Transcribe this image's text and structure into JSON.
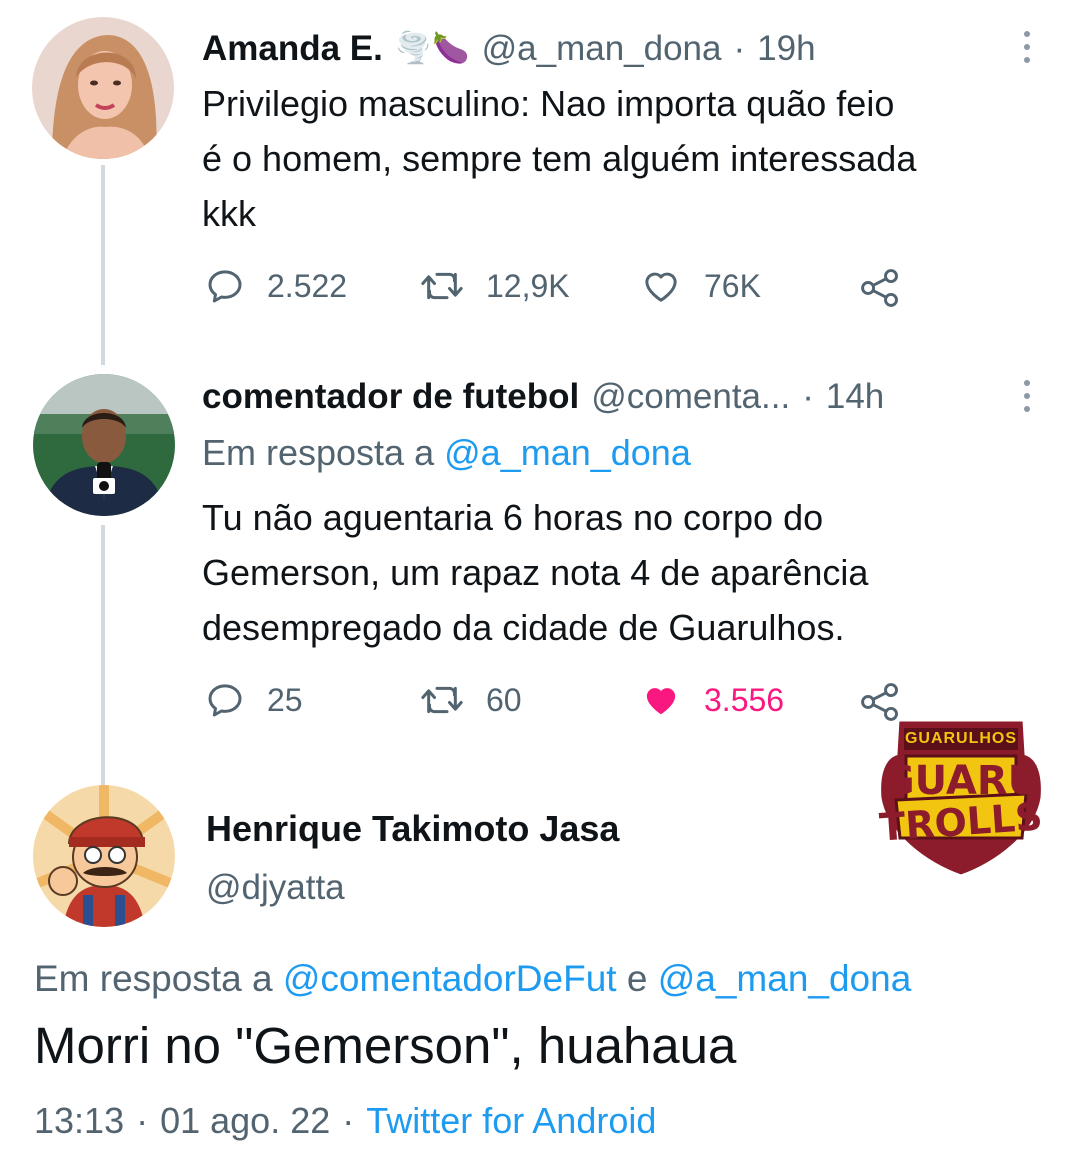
{
  "tweet1": {
    "name": "Amanda E.",
    "emojis": "🌪️🍆",
    "handle": "@a_man_dona",
    "separator": "·",
    "time": "19h",
    "text_lines": [
      "Privilegio masculino: Nao importa quão feio",
      "é o homem, sempre tem alguém interessada",
      "kkk"
    ],
    "replies": "2.522",
    "retweets": "12,9K",
    "likes": "76K",
    "liked": false
  },
  "tweet2": {
    "name": "comentador de futebol",
    "handle": "@comenta...",
    "separator": "·",
    "time": "14h",
    "replying_prefix": "Em resposta a",
    "replying_to": "@a_man_dona",
    "text_lines": [
      "Tu não aguentaria 6 horas no corpo do",
      "Gemerson, um rapaz nota 4 de aparência",
      "desempregado da cidade de Guarulhos."
    ],
    "replies": "25",
    "retweets": "60",
    "likes": "3.556",
    "liked": true
  },
  "tweet3": {
    "name": "Henrique Takimoto Jasa",
    "handle": "@djyatta",
    "replying_prefix": "Em resposta a",
    "replying_to_1": "@comentadorDeFut",
    "replying_conj": "e",
    "replying_to_2": "@a_man_dona",
    "text": "Morri no \"Gemerson\", huahaua",
    "time": "13:13",
    "sep1": "·",
    "date": "01 ago. 22",
    "sep2": "·",
    "source": "Twitter for Android"
  },
  "watermark": {
    "top": "GUARULHOS",
    "line1": "GUARU",
    "line2": "TROLLS"
  },
  "colors": {
    "text": "#0f1419",
    "secondary": "#536471",
    "link": "#1d9bf0",
    "like_active": "#f91880",
    "thread_line": "#cfd9de",
    "watermark_red": "#8c1c2b",
    "watermark_gold": "#f2c511"
  }
}
